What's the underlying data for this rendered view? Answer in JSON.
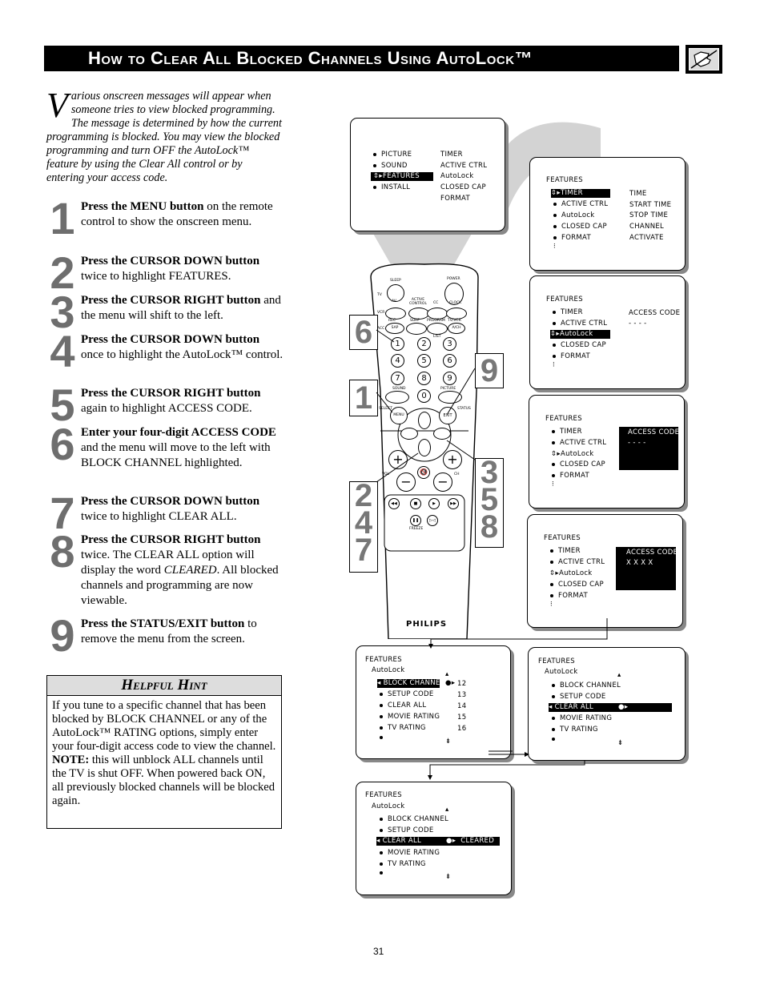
{
  "header": {
    "title": "How to Clear All Blocked Channels Using AutoLock™",
    "icon": "hand-pointing-icon"
  },
  "intro": {
    "dropcap": "V",
    "text": "arious onscreen messages will appear when someone tries to view blocked programming. The message is determined by how the current programming is blocked. You may view the blocked programming and turn OFF the AutoLock™ feature by using the Clear All control or by entering your access code."
  },
  "steps": [
    {
      "num": "1",
      "bold": "Press the MENU button",
      "rest": " on the remote control to show the onscreen menu."
    },
    {
      "num": "2",
      "bold": "Press the CURSOR DOWN button",
      "rest": " twice to highlight FEATURES."
    },
    {
      "num": "3",
      "bold": "Press the CURSOR RIGHT button",
      "rest": " and the menu will shift to the left."
    },
    {
      "num": "4",
      "bold": "Press the CURSOR DOWN button",
      "rest": " once to highlight the AutoLock™ control."
    },
    {
      "num": "5",
      "bold": "Press the CURSOR RIGHT button",
      "rest": " again to highlight ACCESS CODE."
    },
    {
      "num": "6",
      "bold": "Enter your four-digit ACCESS CODE",
      "rest": " and the menu will move to the left with BLOCK CHANNEL highlighted."
    },
    {
      "num": "7",
      "bold": "Press the CURSOR DOWN button",
      "rest": " twice to highlight CLEAR ALL."
    },
    {
      "num": "8",
      "bold": "Press the CURSOR RIGHT button",
      "rest": " twice. The CLEAR ALL option will display the word ",
      "italic": "CLEARED",
      "rest2": ". All blocked channels and programming are now viewable."
    },
    {
      "num": "9",
      "bold": "Press the STATUS/EXIT button",
      "rest": " to remove the menu from the screen."
    }
  ],
  "hint": {
    "title": "Helpful Hint",
    "body": "If you tune to a specific channel that has been blocked by BLOCK CHANNEL or any of the AutoLock™ RATING options, simply enter your four-digit access code to view the channel.",
    "note_label": "NOTE:",
    "note": " this will unblock ALL channels until the TV is shut OFF. When powered back ON, all previously blocked channels will be blocked again."
  },
  "screens": {
    "main_menu": {
      "left": [
        "PICTURE",
        "SOUND",
        "FEATURES",
        "INSTALL"
      ],
      "right": [
        "TIMER",
        "ACTIVE CTRL",
        "AutoLock",
        "CLOSED CAP",
        "FORMAT"
      ],
      "highlight": "FEATURES"
    },
    "features_timer": {
      "heading": "FEATURES",
      "left": [
        "TIMER",
        "ACTIVE CTRL",
        "AutoLock",
        "CLOSED CAP",
        "FORMAT"
      ],
      "right": [
        "TIME",
        "START TIME",
        "STOP TIME",
        "CHANNEL",
        "ACTIVATE"
      ]
    },
    "features_autolock": {
      "heading": "FEATURES",
      "left": [
        "TIMER",
        "ACTIVE CTRL",
        "AutoLock",
        "CLOSED CAP",
        "FORMAT"
      ],
      "access_label": "ACCESS CODE",
      "access_value": "- - - -"
    },
    "features_access_hl": {
      "heading": "FEATURES",
      "left": [
        "TIMER",
        "ACTIVE CTRL",
        "AutoLock",
        "CLOSED CAP",
        "FORMAT"
      ],
      "access_label": "ACCESS CODE",
      "access_value": "- - - -"
    },
    "features_access_entered": {
      "heading": "FEATURES",
      "left": [
        "TIMER",
        "ACTIVE CTRL",
        "AutoLock",
        "CLOSED CAP",
        "FORMAT"
      ],
      "access_label": "ACCESS CODE",
      "access_value": "X X X X"
    },
    "autolock_block": {
      "heading": "FEATURES",
      "sub": "AutoLock",
      "items": [
        "BLOCK CHANNEL",
        "SETUP CODE",
        "CLEAR ALL",
        "MOVIE RATING",
        "TV RATING"
      ],
      "channels": [
        "12",
        "13",
        "14",
        "15",
        "16"
      ]
    },
    "autolock_clear": {
      "heading": "FEATURES",
      "sub": "AutoLock",
      "items": [
        "BLOCK CHANNEL",
        "SETUP CODE",
        "CLEAR ALL",
        "MOVIE RATING",
        "TV RATING"
      ]
    },
    "autolock_cleared": {
      "heading": "FEATURES",
      "sub": "AutoLock",
      "items": [
        "BLOCK CHANNEL",
        "SETUP CODE",
        "CLEAR ALL",
        "MOVIE RATING",
        "TV RATING"
      ],
      "cleared": "CLEARED"
    }
  },
  "remote": {
    "brand": "PHILIPS",
    "labels": {
      "sleep": "SLEEP",
      "power": "POWER",
      "tv": "TV",
      "vcr": "VCR",
      "acc": "ACC",
      "av": "AV",
      "active_control": "ACTIVE CONTROL",
      "cc": "CC",
      "clock": "CLOCK",
      "rec": "REC",
      "sap": "SAP",
      "surf": "SURF",
      "program_list": "PROGRAM",
      "list": "LIST",
      "tvvcr": "TV/VCR",
      "ach": "A/CH",
      "sound": "SOUND",
      "picture": "PICTURE",
      "select": "SELECT",
      "menu": "MENU",
      "exit": "EXIT",
      "status": "STATUS",
      "vol": "VOL",
      "ch": "CH",
      "freeze": "FREEZE"
    },
    "digits": [
      "1",
      "2",
      "3",
      "4",
      "5",
      "6",
      "7",
      "8",
      "9",
      "0"
    ],
    "callouts": {
      "menu": "1",
      "digits": "6",
      "exit": "9",
      "down": "2\n4\n7",
      "right": "3\n5\n8"
    }
  },
  "page_number": "31"
}
